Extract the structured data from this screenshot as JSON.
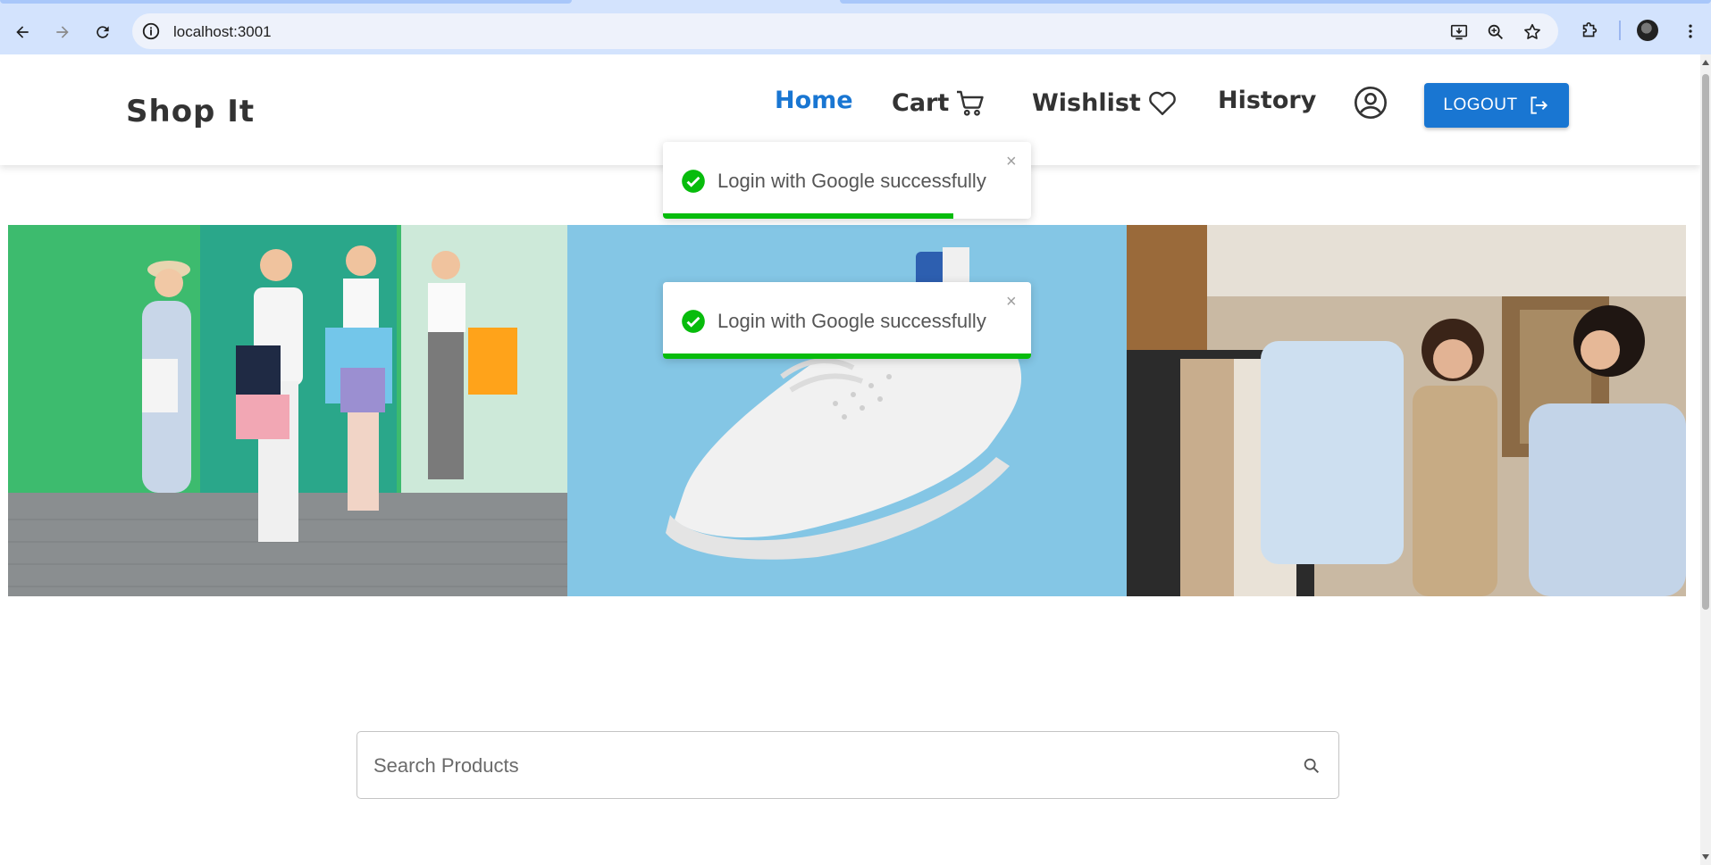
{
  "browser": {
    "url": "localhost:3001"
  },
  "header": {
    "logo": "Shop It",
    "nav": {
      "home": "Home",
      "cart": "Cart",
      "wishlist": "Wishlist",
      "history": "History"
    },
    "logout_label": "LOGOUT"
  },
  "toasts": [
    {
      "message": "Login with Google successfully",
      "close": "×",
      "progress": 0.79
    },
    {
      "message": "Login with Google successfully",
      "close": "×",
      "progress": 1.0
    }
  ],
  "search": {
    "placeholder": "Search Products"
  },
  "colors": {
    "accent": "#1976d2",
    "toast_success": "#07bc0c",
    "text_dark": "#333333"
  }
}
